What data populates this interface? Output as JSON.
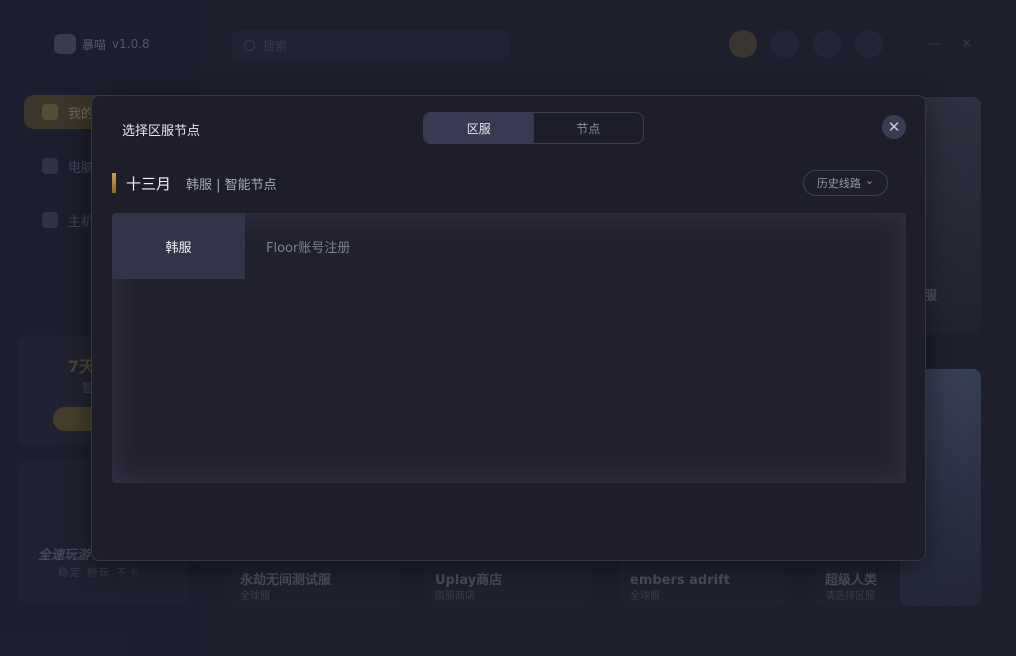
{
  "app": {
    "name": "暴喵",
    "version": "v1.0.8",
    "search_placeholder": "搜索",
    "nav": [
      {
        "label": "我的"
      },
      {
        "label": "电脑"
      },
      {
        "label": "主机"
      }
    ],
    "promo": {
      "title": "7天",
      "subtitle": "智"
    },
    "promo2": {
      "title": "全速玩游",
      "subtitle": "稳定 畅玩 不卡"
    },
    "games": [
      {
        "title": "永劫无间测试服",
        "tag": "全球服"
      },
      {
        "title": "Uplay商店",
        "tag": "国服商店"
      },
      {
        "title": "embers adrift",
        "tag": "全球服"
      },
      {
        "title": "超级人类",
        "tag": "请选择区服"
      }
    ],
    "top_card_label": "服"
  },
  "modal": {
    "title": "选择区服节点",
    "tabs": [
      {
        "label": "区服",
        "active": true
      },
      {
        "label": "节点",
        "active": false
      }
    ],
    "close_glyph": "✕",
    "game_name": "十三月",
    "selection": "韩服 | 智能节点",
    "history_label": "历史线路",
    "history_chevron": "⌄",
    "regions": [
      {
        "label": "韩服",
        "active": true
      }
    ],
    "nodes": [
      {
        "label": "Floor账号注册"
      }
    ]
  },
  "colors": {
    "accent": "#c9a04a",
    "modal_bg": "#1e1e2b",
    "active_tab": "#383a52"
  }
}
